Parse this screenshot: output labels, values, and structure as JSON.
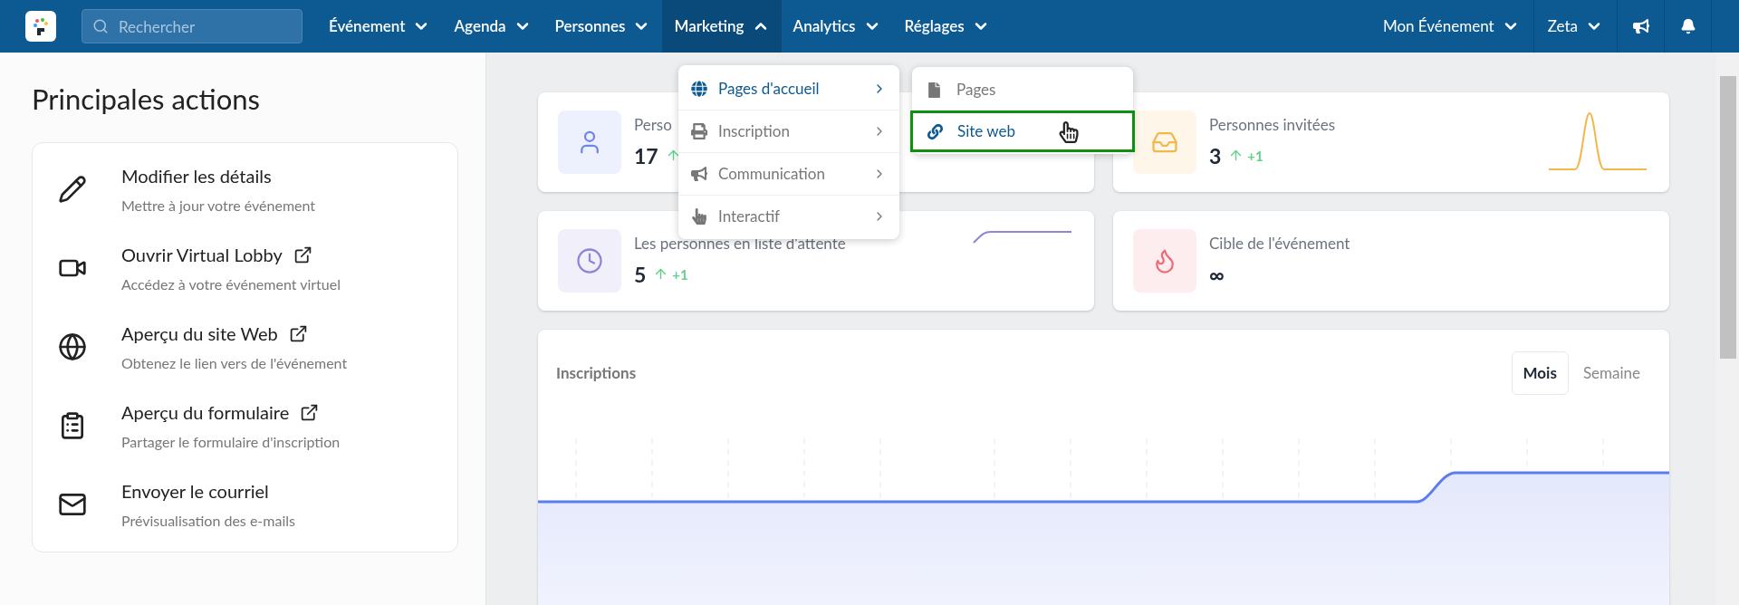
{
  "nav": {
    "search": {
      "placeholder": "Rechercher"
    },
    "menus": [
      {
        "label": "Événement",
        "expanded": false
      },
      {
        "label": "Agenda",
        "expanded": false
      },
      {
        "label": "Personnes",
        "expanded": false
      },
      {
        "label": "Marketing",
        "expanded": true
      },
      {
        "label": "Analytics",
        "expanded": false
      },
      {
        "label": "Réglages",
        "expanded": false
      }
    ],
    "right_menus": [
      {
        "label": "Mon Événement"
      },
      {
        "label": "Zeta"
      }
    ]
  },
  "dropdown": {
    "items": [
      {
        "label": "Pages d'accueil",
        "selected": true
      },
      {
        "label": "Inscription",
        "selected": false
      },
      {
        "label": "Communication",
        "selected": false
      },
      {
        "label": "Interactif",
        "selected": false
      }
    ],
    "submenu": [
      {
        "label": "Pages",
        "selected": false
      },
      {
        "label": "Site web",
        "selected": true
      }
    ]
  },
  "sidebar": {
    "title": "Principales actions",
    "actions": [
      {
        "title": "Modifier les détails",
        "subtitle": "Mettre à jour votre événement",
        "external": false
      },
      {
        "title": "Ouvrir Virtual Lobby",
        "subtitle": "Accédez à votre événement virtuel",
        "external": true
      },
      {
        "title": "Aperçu du site Web",
        "subtitle": "Obtenez le lien vers de l'événement",
        "external": true
      },
      {
        "title": "Aperçu du formulaire",
        "subtitle": "Partager le formulaire d'inscription",
        "external": true
      },
      {
        "title": "Envoyer le courriel",
        "subtitle": "Prévisualisation des e-mails",
        "external": false
      }
    ]
  },
  "stats": [
    {
      "label": "Perso",
      "value": "17",
      "rising": true,
      "color": "#6d83f2"
    },
    {
      "label": "Personnes invitées",
      "value": "3",
      "rising": true,
      "delta": "+1",
      "color": "#f2b84b"
    },
    {
      "label": "Les personnes en liste d'attente",
      "value": "5",
      "rising": true,
      "delta": "+1",
      "color": "#8b86d9"
    },
    {
      "label": "Cible de l'événement",
      "value": "∞",
      "rising": false,
      "color": "#f06a78"
    }
  ],
  "chart": {
    "title": "Inscriptions",
    "tabs": [
      {
        "label": "Mois",
        "selected": true
      },
      {
        "label": "Semaine",
        "selected": false
      }
    ]
  }
}
